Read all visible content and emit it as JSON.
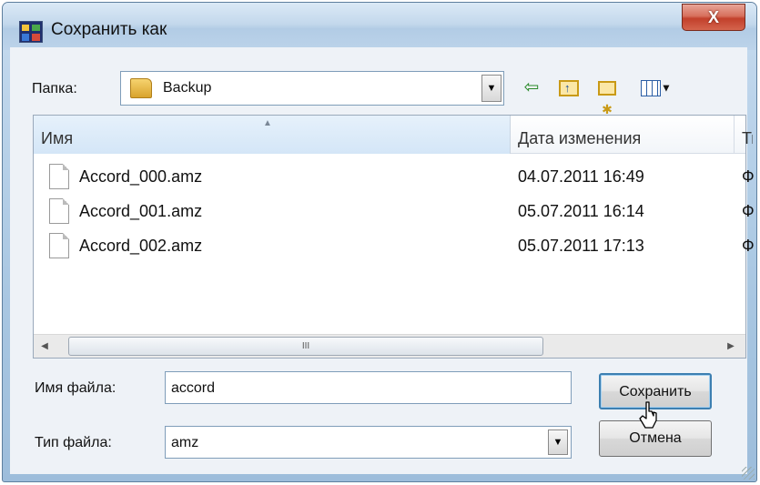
{
  "window": {
    "title": "Сохранить как",
    "close_glyph": "X",
    "icon": "app-icon"
  },
  "folder_bar": {
    "label": "Папка:",
    "current_folder": "Backup",
    "icons": [
      "back-arrow-icon",
      "up-folder-icon",
      "new-folder-icon",
      "views-menu-icon"
    ]
  },
  "file_list": {
    "columns": [
      "Имя",
      "Дата изменения",
      "Ти"
    ],
    "rows": [
      {
        "name": "Accord_000.amz",
        "date": "04.07.2011 16:49",
        "type": "Ф"
      },
      {
        "name": "Accord_001.amz",
        "date": "05.07.2011 16:14",
        "type": "Ф"
      },
      {
        "name": "Accord_002.amz",
        "date": "05.07.2011 17:13",
        "type": "Ф"
      }
    ],
    "scrollbar_thumb_glyph": "III"
  },
  "file_name": {
    "label": "Имя файла:",
    "value": "accord"
  },
  "file_type": {
    "label": "Тип файла:",
    "value": "amz"
  },
  "buttons": {
    "save": "Сохранить",
    "cancel": "Отмена"
  }
}
